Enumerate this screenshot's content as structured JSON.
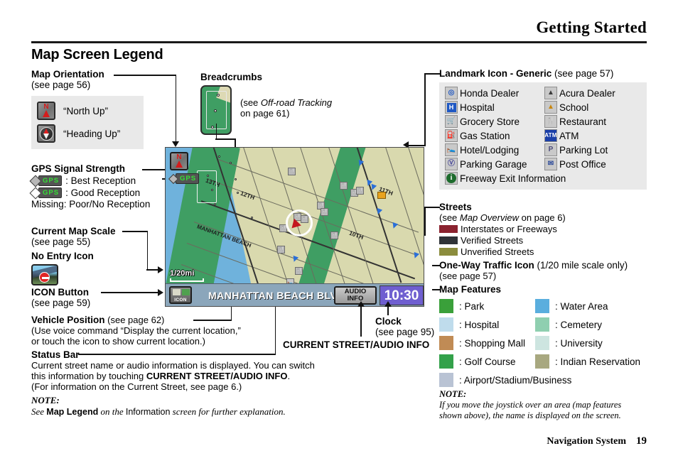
{
  "header": {
    "title": "Getting Started"
  },
  "footer": {
    "book": "Navigation System",
    "page": "19"
  },
  "section": {
    "title": "Map Screen Legend"
  },
  "map_orientation": {
    "heading": "Map Orientation",
    "see": "(see page 56)",
    "options": [
      {
        "icon": "north-up-icon",
        "label": "“North Up”"
      },
      {
        "icon": "heading-up-icon",
        "label": "“Heading Up”"
      }
    ]
  },
  "gps": {
    "heading": "GPS Signal Strength",
    "rows": [
      {
        "icon": "gps-filled-icon",
        "badge": "GPS",
        "label": ": Best Reception"
      },
      {
        "icon": "gps-hollow-icon",
        "badge": "GPS",
        "label": ": Good Reception"
      }
    ],
    "missing": "Missing: Poor/No Reception"
  },
  "map_scale": {
    "heading": "Current Map Scale",
    "see": "(see page 55)"
  },
  "no_entry": {
    "heading": "No Entry Icon",
    "icon": "no-entry-icon"
  },
  "icon_button": {
    "heading": "ICON Button",
    "see": "(see page 59)"
  },
  "vehicle_position": {
    "heading": "Vehicle Position",
    "see": "(see page 62)",
    "line1": "(Use voice command “Display the current location,”",
    "line2": "or touch the icon to show current location.)"
  },
  "status_bar": {
    "heading": "Status Bar",
    "line1": "Current street name or audio information is displayed. You can switch",
    "line2_pre": "this information by touching ",
    "line2_bold": "CURRENT STREET/AUDIO INFO",
    "line2_post": ".",
    "line3": "(For information on the Current Street, see page 6.)"
  },
  "note_left": {
    "title": "NOTE:",
    "pre": "See ",
    "bold": "Map Legend",
    "mid": " on the ",
    "plain": "Information",
    "post": " screen for further explanation."
  },
  "breadcrumbs": {
    "heading": "Breadcrumbs",
    "note_line1_pre": "(see ",
    "note_line1_ital": "Off-road Tracking",
    "note_line2": "on page 61)"
  },
  "landmark": {
    "heading_bold": "Landmark Icon - Generic",
    "heading_see": " (see page 57)",
    "items": [
      {
        "icon": "honda-dealer-icon",
        "label": "Honda Dealer"
      },
      {
        "icon": "acura-dealer-icon",
        "label": "Acura Dealer"
      },
      {
        "icon": "hospital-icon",
        "label": "Hospital"
      },
      {
        "icon": "school-icon",
        "label": "School"
      },
      {
        "icon": "grocery-store-icon",
        "label": "Grocery Store"
      },
      {
        "icon": "restaurant-icon",
        "label": "Restaurant"
      },
      {
        "icon": "gas-station-icon",
        "label": "Gas Station"
      },
      {
        "icon": "atm-icon",
        "label": "ATM"
      },
      {
        "icon": "hotel-lodging-icon",
        "label": "Hotel/Lodging"
      },
      {
        "icon": "parking-lot-icon",
        "label": "Parking Lot"
      },
      {
        "icon": "parking-garage-icon",
        "label": "Parking Garage"
      },
      {
        "icon": "post-office-icon",
        "label": "Post Office"
      }
    ],
    "wide_item": {
      "icon": "freeway-exit-info-icon",
      "label": "Freeway Exit Information"
    }
  },
  "streets": {
    "heading": "Streets",
    "see_pre": "(see ",
    "see_ital": "Map Overview",
    "see_post": " on page 6)",
    "rows": [
      {
        "color": "#8b2330",
        "label": "Interstates or Freeways"
      },
      {
        "color": "#2f3338",
        "label": "Verified Streets"
      },
      {
        "color": "#8b8c3d",
        "label": "Unverified Streets"
      }
    ]
  },
  "one_way": {
    "heading_bold": "One-Way Traffic Icon",
    "heading_see": " (1/20 mile scale only)",
    "sub": "(see page 57)"
  },
  "map_features": {
    "heading": "Map Features",
    "items": [
      {
        "color": "#3aa03a",
        "label": ": Park"
      },
      {
        "color": "#5aaede",
        "label": ": Water Area"
      },
      {
        "color": "#bfdcec",
        "label": ": Hospital"
      },
      {
        "color": "#8fcfb0",
        "label": ": Cemetery"
      },
      {
        "color": "#c08b55",
        "label": ": Shopping Mall"
      },
      {
        "color": "#cde5e0",
        "label": ": University"
      },
      {
        "color": "#33a14a",
        "label": ": Golf Course"
      },
      {
        "color": "#a8a880",
        "label": ": Indian Reservation"
      }
    ],
    "wide_item": {
      "color": "#b9c3d4",
      "label": ": Airport/Stadium/Business"
    }
  },
  "note_right": {
    "title": "NOTE:",
    "line1": "If you move the joystick over an area (map features",
    "line2": "shown above), the name is displayed on the screen."
  },
  "map_screenshot": {
    "orientation_icon": "north-up-icon",
    "gps_badge": "GPS",
    "scale": "1/20mi",
    "icon_button_label": "ICON",
    "street_name": "MANHATTAN BEACH BLVD",
    "audio_info_line1": "AUDIO",
    "audio_info_line2": "INFO",
    "clock": "10:30",
    "street_labels": [
      "13TH",
      "12TH",
      "11TH",
      "10TH",
      "MANHATTAN BEACH"
    ]
  },
  "callouts": {
    "current_street_audio_info": "CURRENT STREET/AUDIO INFO",
    "clock_heading": "Clock",
    "clock_see": "(see page 95)"
  }
}
